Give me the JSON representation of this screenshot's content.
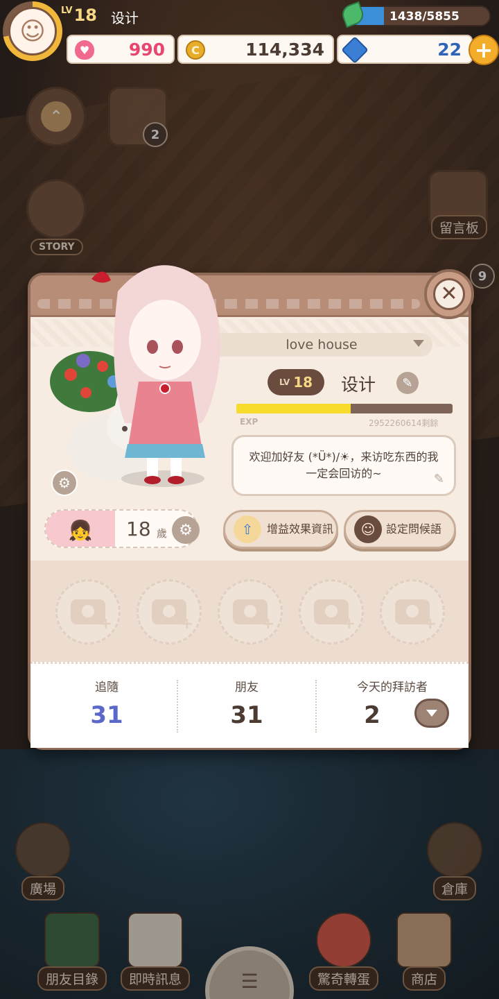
{
  "hud": {
    "level_tag": "LV",
    "level": "18",
    "player_name": "设计",
    "exp_text": "1438/5855",
    "exp_fraction": 0.2456,
    "hearts": "990",
    "coins": "114,334",
    "gems": "22"
  },
  "side_buttons": {
    "story_label": "STORY",
    "calendar_badge": "2",
    "guestbook_label": "留言板",
    "notify_badge": "9"
  },
  "bottom_nav": {
    "plaza": "廣場",
    "warehouse": "倉庫",
    "friend_list": "朋友目錄",
    "messages": "即時訊息",
    "gacha": "驚奇轉蛋",
    "shop": "商店"
  },
  "profile": {
    "house_name": "love house",
    "level_tag": "LV",
    "level": "18",
    "name": "设计",
    "exp_label": "EXP",
    "exp_remaining": "2952260614剩餘",
    "exp_fraction": 0.53,
    "greeting": "欢迎加好友 (*Ü*)/☀，来访吃东西的我一定会回访的~",
    "age": "18",
    "age_unit": "歲",
    "buff_button": "增益效果資訊",
    "greeting_button": "設定問候語",
    "photo_slots": 5
  },
  "stats": {
    "follow_label": "追隨",
    "follow_value": "31",
    "friends_label": "朋友",
    "friends_value": "31",
    "visitors_label": "今天的拜訪者",
    "visitors_value": "2"
  },
  "colors": {
    "follow_value": "#5b67c9",
    "exp_fill": "#f7dc2e",
    "card_bg": "#f6ece2",
    "header": "#b88d78"
  }
}
